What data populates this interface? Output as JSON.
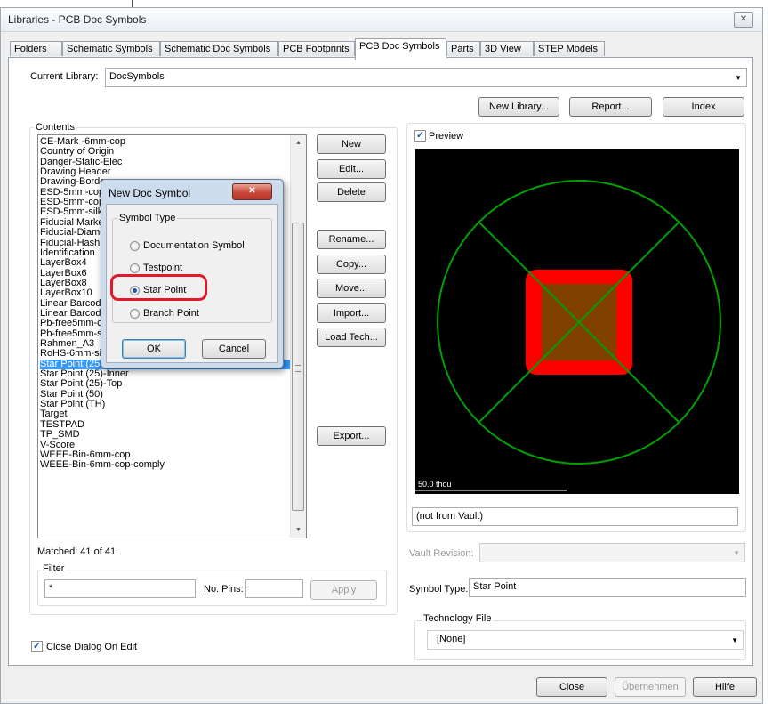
{
  "window": {
    "title": "Libraries - PCB Doc Symbols",
    "close_glyph": "✕"
  },
  "tabs": [
    {
      "label": "Folders"
    },
    {
      "label": "Schematic Symbols"
    },
    {
      "label": "Schematic Doc Symbols"
    },
    {
      "label": "PCB Footprints"
    },
    {
      "label": "PCB Doc Symbols"
    },
    {
      "label": "Parts"
    },
    {
      "label": "3D View"
    },
    {
      "label": "STEP Models"
    }
  ],
  "current_library": {
    "label": "Current Library:",
    "value": "DocSymbols"
  },
  "top_buttons": {
    "new_library": "New Library...",
    "report": "Report...",
    "index": "Index"
  },
  "contents": {
    "label": "Contents",
    "items": [
      "CE-Mark -6mm-cop",
      "Country of Origin",
      "Danger-Static-Elec",
      "Drawing Header",
      "Drawing-Border",
      "ESD-5mm-cop",
      "ESD-5mm-cop",
      "ESD-5mm-silk",
      "Fiducial Marker",
      "Fiducial-Diamond",
      "Fiducial-Hash",
      "Identification",
      "LayerBox4",
      "LayerBox6",
      "LayerBox8",
      "LayerBox10",
      "Linear Barcode",
      "Linear Barcode",
      "Pb-free5mm-cop",
      "Pb-free5mm-silk-assy",
      "Rahmen_A3",
      "RoHS-6mm-silk-assy",
      "Star Point (25)",
      "Star Point (25)-Inner",
      "Star Point (25)-Top",
      "Star Point (50)",
      "Star Point (TH)",
      "Target",
      "TESTPAD",
      "TP_SMD",
      "V-Score",
      "WEEE-Bin-6mm-cop",
      "WEEE-Bin-6mm-cop-comply"
    ],
    "selected_index": 22,
    "scroll_up": "▲",
    "scroll_down": "▼"
  },
  "side_buttons": {
    "new": "New",
    "edit": "Edit...",
    "delete": "Delete",
    "rename": "Rename...",
    "copy": "Copy...",
    "move": "Move...",
    "import": "Import...",
    "load_tech": "Load Tech...",
    "export": "Export..."
  },
  "matched": "Matched: 41 of 41",
  "filter": {
    "label": "Filter",
    "value": "*",
    "pins_label": "No. Pins:",
    "pins_value": "",
    "apply": "Apply"
  },
  "close_on_edit": {
    "label": "Close Dialog On Edit",
    "checked": true
  },
  "preview": {
    "label": "Preview",
    "checked": true,
    "scale_text": "50.0 thou",
    "vault_status": "(not from Vault)"
  },
  "vault_revision": {
    "label": "Vault Revision:",
    "value": ""
  },
  "symbol_type": {
    "label": "Symbol Type:",
    "value": "Star Point"
  },
  "technology_file": {
    "label": "Technology File",
    "value": "[None]"
  },
  "bottom_buttons": {
    "close": "Close",
    "apply": "Übernehmen",
    "help": "Hilfe"
  },
  "dialog": {
    "title": "New Doc Symbol",
    "close_glyph": "✕",
    "group_label": "Symbol Type",
    "options": [
      {
        "label": "Documentation Symbol"
      },
      {
        "label": "Testpoint"
      },
      {
        "label": "Star Point"
      },
      {
        "label": "Branch Point"
      }
    ],
    "selected_index": 2,
    "ok": "OK",
    "cancel": "Cancel"
  },
  "colors": {
    "selection": "#3399ff",
    "pad": "#ff0000",
    "pad_fill": "#804000",
    "outline": "#00a000",
    "highlight": "#e2192a"
  }
}
